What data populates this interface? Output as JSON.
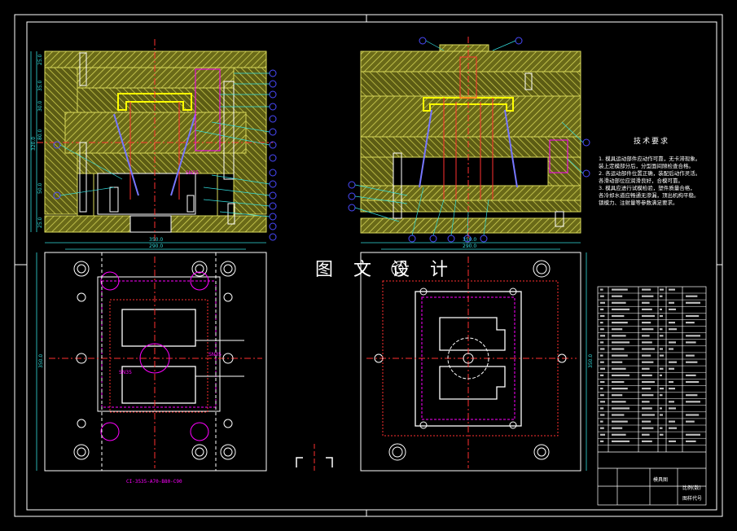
{
  "watermark": "图 文 设 计",
  "tech_notes": {
    "title": "技术要求",
    "lines": [
      "1. 模具运动部件应动作可靠，无卡滞现象。",
      "装上定模部分后，分型面间隙检查合格。",
      "2. 各运动部件位置正确，装配后动作灵活。",
      "各滑动部位应润滑良好，合模可靠。",
      "3. 模具应进行试模检验，塑件质量合格，",
      "各冷却水道应畅通无渗漏，顶出机构平稳。",
      "锁模力、注射量等参数满足要求。"
    ]
  },
  "dims": {
    "left_width_1": "350.0",
    "left_width_2": "290.0",
    "right_width_1": "350.0",
    "right_width_2": "290.0",
    "left_height": "350.0",
    "right_height": "350.0",
    "sec_a": "25.0",
    "sec_b": "35.0",
    "sec_c": "30.0",
    "sec_d": "80.0",
    "sec_e": "50.0",
    "sec_f": "25.0",
    "total": "320.0",
    "part_label_1": "SN35",
    "part_label_2": "SN35",
    "part_label_3": "SN35"
  },
  "mold_base_code": "CI-3535-A70-B80-C90",
  "title_block": {
    "drawing_name": "模具图",
    "field_2": "比例(数)",
    "field_3": "图样代号"
  },
  "colors": {
    "background": "#000000",
    "plate": "#c8c84a",
    "border": "#ffffff",
    "centerline": "#ff3030",
    "dimension": "#33dddd",
    "balloon": "#4a4aff",
    "part": "#ff00ff",
    "cavity": "#ffff00"
  }
}
